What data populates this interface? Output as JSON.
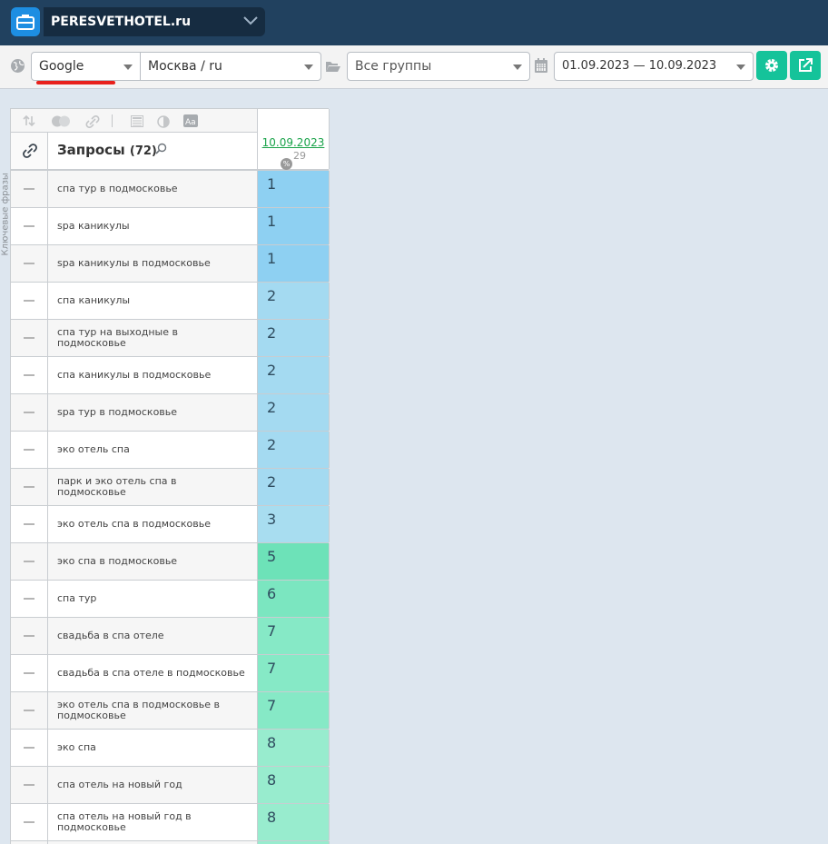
{
  "header": {
    "project": "PERESVETHOTEL.ru"
  },
  "toolbar": {
    "engine": "Google",
    "region": "Москва / ru",
    "groups": "Все группы",
    "date_range": "01.09.2023 — 10.09.2023"
  },
  "side_label": "Ключевые фразы",
  "table": {
    "title": "Запросы",
    "count": "(72)",
    "date_column": "10.09.2023",
    "date_sub": "29",
    "rows": [
      {
        "query": "спа тур в подмосковье",
        "pos": "1",
        "color": "#8ed0f2"
      },
      {
        "query": "spa каникулы",
        "pos": "1",
        "color": "#8ed0f2"
      },
      {
        "query": "spa каникулы в подмосковье",
        "pos": "1",
        "color": "#8ed0f2"
      },
      {
        "query": "спа каникулы",
        "pos": "2",
        "color": "#a4daf1"
      },
      {
        "query": "спа тур на выходные в подмосковье",
        "pos": "2",
        "color": "#a4daf1"
      },
      {
        "query": "спа каникулы в подмосковье",
        "pos": "2",
        "color": "#a4daf1"
      },
      {
        "query": "spa тур в подмосковье",
        "pos": "2",
        "color": "#a4daf1"
      },
      {
        "query": "эко отель спа",
        "pos": "2",
        "color": "#a4daf1"
      },
      {
        "query": "парк и эко отель спа в подмосковье",
        "pos": "2",
        "color": "#a4daf1"
      },
      {
        "query": "эко отель спа в подмосковье",
        "pos": "3",
        "color": "#a8ddf0"
      },
      {
        "query": "эко спа в подмосковье",
        "pos": "5",
        "color": "#6de2b8"
      },
      {
        "query": "спа тур",
        "pos": "6",
        "color": "#7be6c0"
      },
      {
        "query": "свадьба в спа отеле",
        "pos": "7",
        "color": "#86e9c6"
      },
      {
        "query": "свадьба в спа отеле в подмосковье",
        "pos": "7",
        "color": "#86e9c6"
      },
      {
        "query": "эко отель спа в подмосковье в подмосковье",
        "pos": "7",
        "color": "#86e9c6"
      },
      {
        "query": "эко спа",
        "pos": "8",
        "color": "#98ecce"
      },
      {
        "query": "спа отель на новый год",
        "pos": "8",
        "color": "#98ecce"
      },
      {
        "query": "спа отель на новый год в подмосковье",
        "pos": "8",
        "color": "#98ecce"
      },
      {
        "query": "",
        "pos": "",
        "color": "#98ecce"
      }
    ]
  }
}
